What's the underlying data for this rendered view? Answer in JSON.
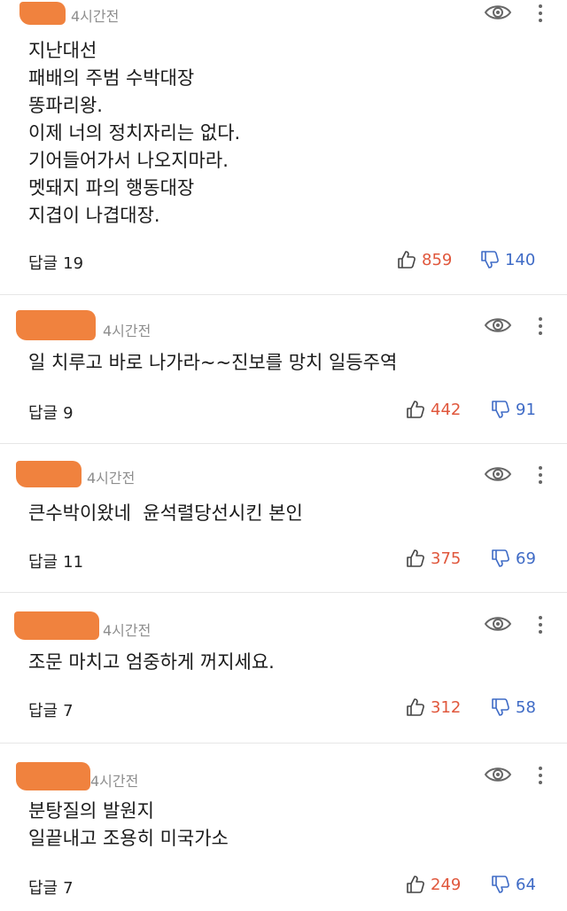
{
  "comments": [
    {
      "time": "4시간전",
      "lines": [
        "지난대선",
        "패배의 주범 수박대장",
        "똥파리왕.",
        "이제 너의 정치자리는 없다.",
        "기어들어가서 나오지마라.",
        "멧돼지 파의 행동대장",
        "지겹이 나겹대장."
      ],
      "reply_label": "답글",
      "reply_count": "19",
      "likes": "859",
      "dislikes": "140"
    },
    {
      "time": "4시간전",
      "lines": [
        "일 치루고 바로 나가라~~진보를 망치 일등주역"
      ],
      "reply_label": "답글",
      "reply_count": "9",
      "likes": "442",
      "dislikes": "91"
    },
    {
      "time": "4시간전",
      "lines": [
        "큰수박이왔네  윤석렬당선시킨 본인"
      ],
      "reply_label": "답글",
      "reply_count": "11",
      "likes": "375",
      "dislikes": "69"
    },
    {
      "time": "4시간전",
      "lines": [
        "조문 마치고 엄중하게 꺼지세요."
      ],
      "reply_label": "답글",
      "reply_count": "7",
      "likes": "312",
      "dislikes": "58"
    },
    {
      "time": "4시간전",
      "lines": [
        "분탕질의 발원지",
        "일끝내고 조용히 미국가소"
      ],
      "reply_label": "답글",
      "reply_count": "7",
      "likes": "249",
      "dislikes": "64"
    }
  ],
  "colors": {
    "like": "#e0573c",
    "dislike": "#3f6bc6",
    "redaction": "#f0823e",
    "time": "#8e8e8e"
  },
  "icons": {
    "view": "eye-icon",
    "menu": "more-vertical-icon",
    "like": "thumbs-up-icon",
    "dislike": "thumbs-down-icon"
  }
}
